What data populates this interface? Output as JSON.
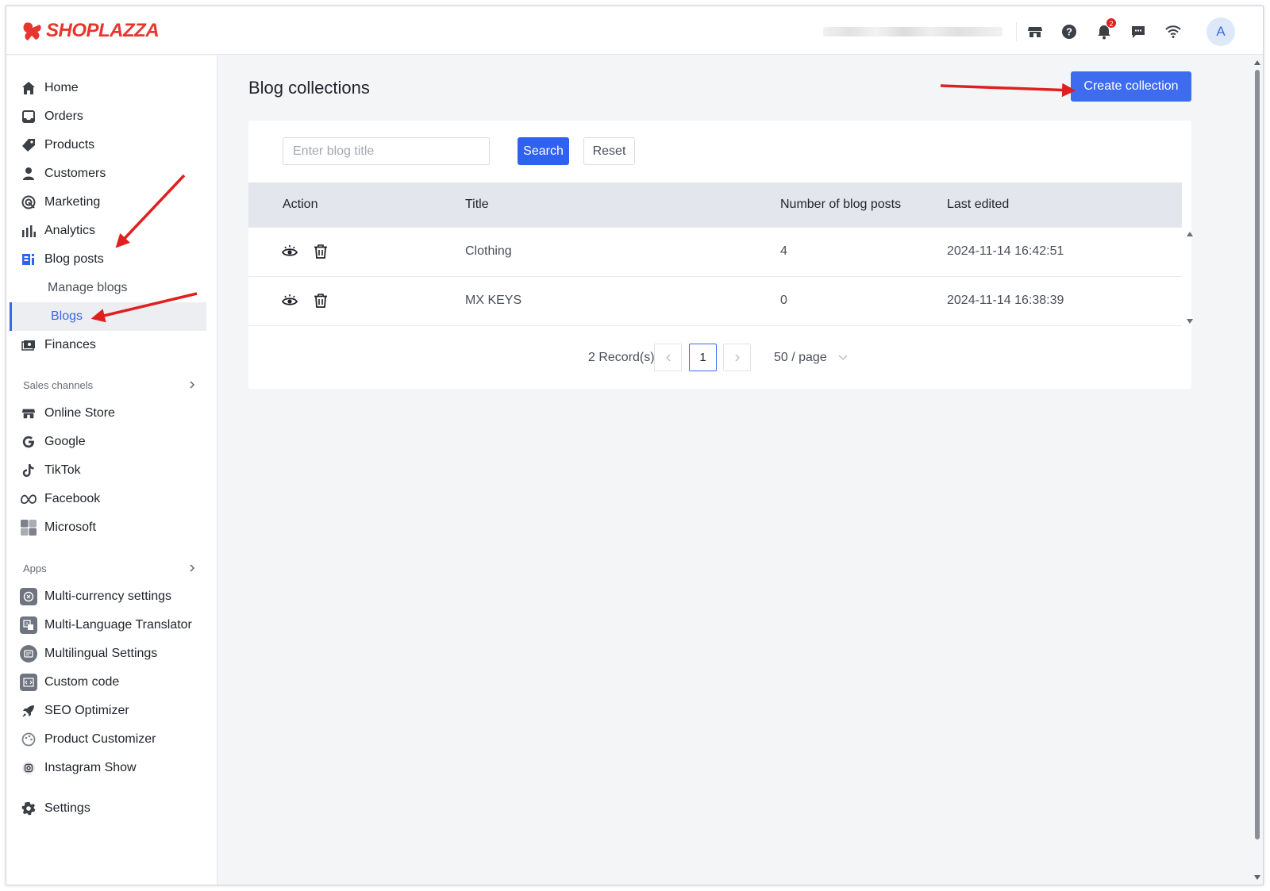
{
  "brand": {
    "name": "SHOPLAZZA",
    "color": "#e8362f"
  },
  "header": {
    "icons": [
      "store-icon",
      "help-icon",
      "bell-icon",
      "chat-icon",
      "wifi-icon"
    ],
    "notification_count": "2",
    "avatar_initial": "A"
  },
  "sidebar": {
    "main": [
      {
        "label": "Home",
        "icon": "home-icon"
      },
      {
        "label": "Orders",
        "icon": "inbox-icon"
      },
      {
        "label": "Products",
        "icon": "tag-icon"
      },
      {
        "label": "Customers",
        "icon": "person-icon"
      },
      {
        "label": "Marketing",
        "icon": "target-icon"
      },
      {
        "label": "Analytics",
        "icon": "bar-chart-icon"
      },
      {
        "label": "Blog posts",
        "icon": "blog-icon"
      }
    ],
    "blog_sub": [
      {
        "label": "Manage blogs"
      },
      {
        "label": "Blogs"
      }
    ],
    "finances": {
      "label": "Finances",
      "icon": "finance-icon"
    },
    "sales_channels_label": "Sales channels",
    "sales_channels": [
      {
        "label": "Online Store",
        "icon": "store-icon"
      },
      {
        "label": "Google",
        "icon": "google-icon"
      },
      {
        "label": "TikTok",
        "icon": "tiktok-icon"
      },
      {
        "label": "Facebook",
        "icon": "meta-icon"
      },
      {
        "label": "Microsoft",
        "icon": "microsoft-icon"
      }
    ],
    "apps_label": "Apps",
    "apps": [
      {
        "label": "Multi-currency settings"
      },
      {
        "label": "Multi-Language Translator"
      },
      {
        "label": "Multilingual Settings"
      },
      {
        "label": "Custom code"
      },
      {
        "label": "SEO Optimizer"
      },
      {
        "label": "Product Customizer"
      },
      {
        "label": "Instagram Show"
      }
    ],
    "settings": {
      "label": "Settings",
      "icon": "gear-icon"
    }
  },
  "main": {
    "title": "Blog collections",
    "create_button": "Create collection",
    "search": {
      "placeholder": "Enter blog title",
      "value": "",
      "search_label": "Search",
      "reset_label": "Reset"
    },
    "table": {
      "columns": [
        "Action",
        "Title",
        "Number of blog posts",
        "Last edited"
      ],
      "rows": [
        {
          "title": "Clothing",
          "posts": "4",
          "last_edited": "2024-11-14 16:42:51"
        },
        {
          "title": "MX KEYS",
          "posts": "0",
          "last_edited": "2024-11-14 16:38:39"
        }
      ]
    },
    "pagination": {
      "records": "2 Record(s)",
      "current_page": "1",
      "page_size": "50 / page"
    }
  },
  "colors": {
    "primary": "#3d6cf0",
    "annotation_arrow": "#e0201f",
    "selected_nav": "#3a66e8"
  }
}
